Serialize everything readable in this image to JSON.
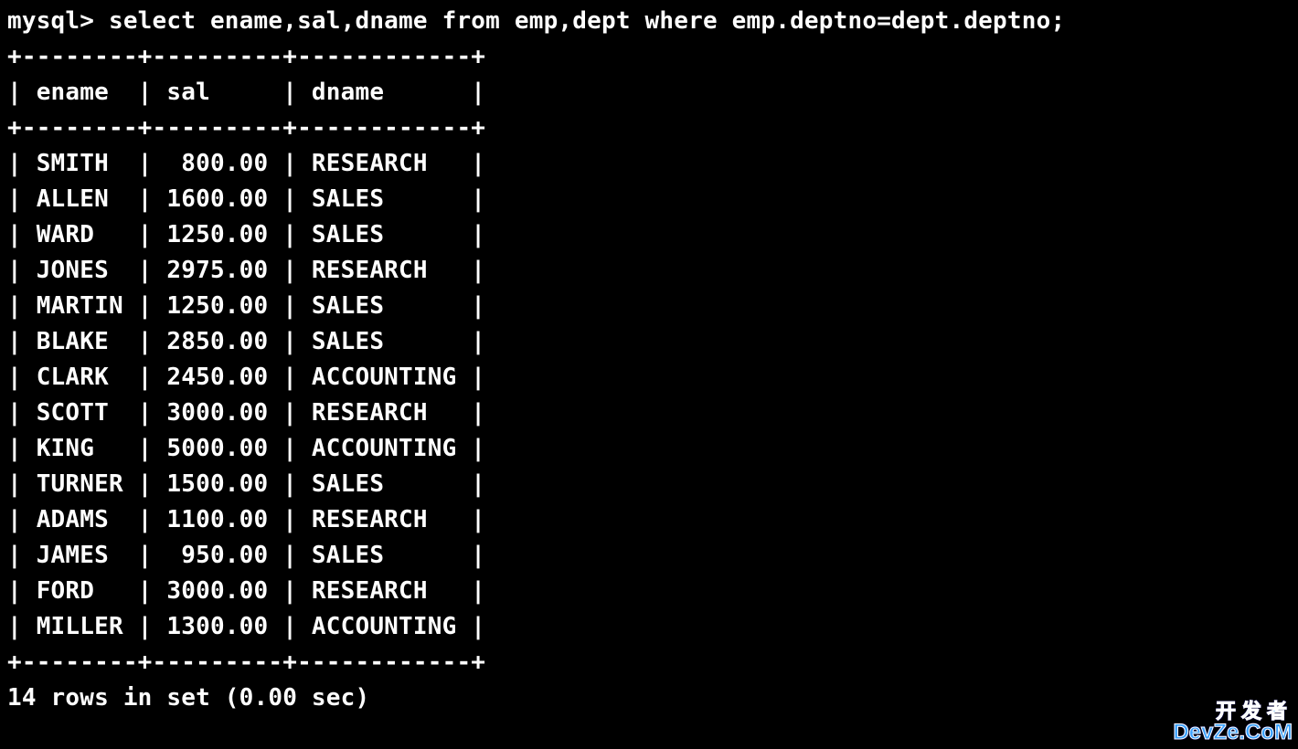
{
  "terminal": {
    "prompt": "mysql>",
    "query": "select ename,sal,dname from emp,dept where emp.deptno=dept.deptno;",
    "columns": [
      "ename",
      "sal",
      "dname"
    ],
    "col_widths": {
      "ename": 8,
      "sal": 9,
      "dname": 12
    },
    "rows": [
      {
        "ename": "SMITH",
        "sal": "800.00",
        "dname": "RESEARCH"
      },
      {
        "ename": "ALLEN",
        "sal": "1600.00",
        "dname": "SALES"
      },
      {
        "ename": "WARD",
        "sal": "1250.00",
        "dname": "SALES"
      },
      {
        "ename": "JONES",
        "sal": "2975.00",
        "dname": "RESEARCH"
      },
      {
        "ename": "MARTIN",
        "sal": "1250.00",
        "dname": "SALES"
      },
      {
        "ename": "BLAKE",
        "sal": "2850.00",
        "dname": "SALES"
      },
      {
        "ename": "CLARK",
        "sal": "2450.00",
        "dname": "ACCOUNTING"
      },
      {
        "ename": "SCOTT",
        "sal": "3000.00",
        "dname": "RESEARCH"
      },
      {
        "ename": "KING",
        "sal": "5000.00",
        "dname": "ACCOUNTING"
      },
      {
        "ename": "TURNER",
        "sal": "1500.00",
        "dname": "SALES"
      },
      {
        "ename": "ADAMS",
        "sal": "1100.00",
        "dname": "RESEARCH"
      },
      {
        "ename": "JAMES",
        "sal": "950.00",
        "dname": "SALES"
      },
      {
        "ename": "FORD",
        "sal": "3000.00",
        "dname": "RESEARCH"
      },
      {
        "ename": "MILLER",
        "sal": "1300.00",
        "dname": "ACCOUNTING"
      }
    ],
    "footer": "14 rows in set (0.00 sec)"
  },
  "watermark": {
    "line1": "开发者",
    "line2": "DevZe.CoM"
  }
}
